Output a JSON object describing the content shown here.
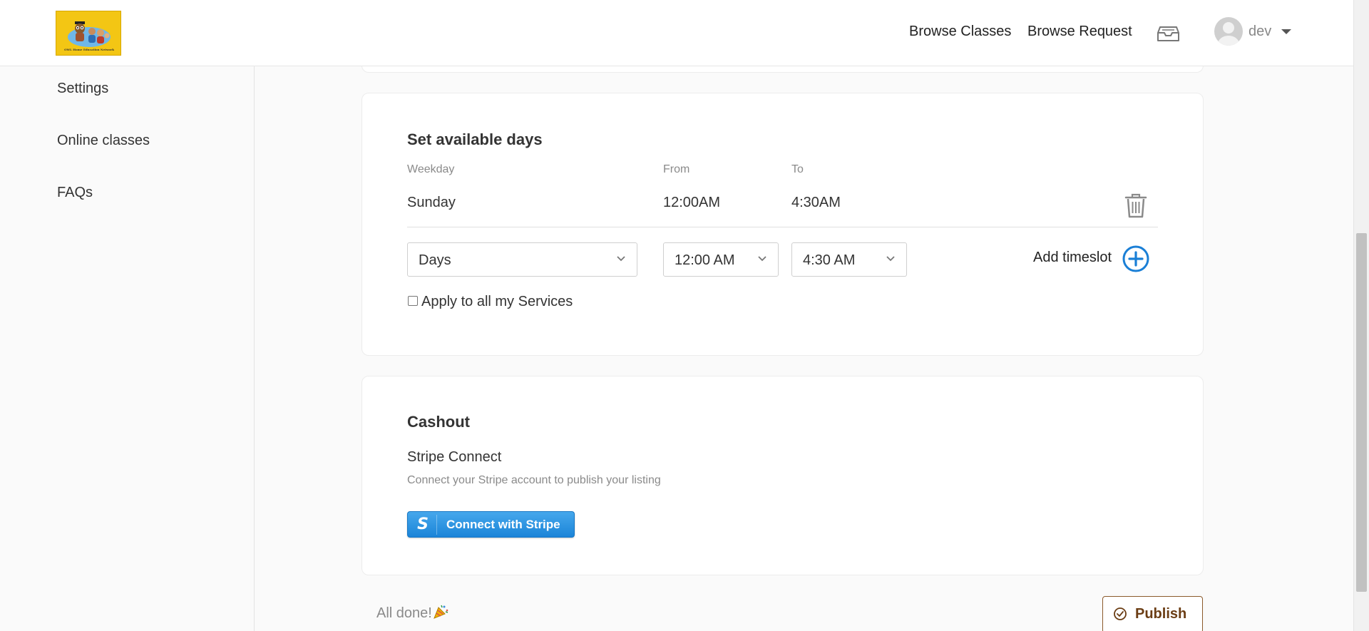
{
  "header": {
    "logo_caption": "OWL Home Education Network",
    "nav": [
      {
        "label": "Browse Classes"
      },
      {
        "label": "Browse Request"
      }
    ],
    "user": {
      "name": "dev"
    }
  },
  "sidebar": {
    "items": [
      {
        "label": "Settings"
      },
      {
        "label": "Online classes"
      },
      {
        "label": "FAQs"
      }
    ]
  },
  "available_days": {
    "title": "Set available days",
    "columns": {
      "weekday": "Weekday",
      "from": "From",
      "to": "To"
    },
    "rows": [
      {
        "weekday": "Sunday",
        "from": "12:00AM",
        "to": "4:30AM"
      }
    ],
    "new_slot": {
      "day_value": "Days",
      "from_value": "12:00 AM",
      "to_value": "4:30 AM",
      "add_label": "Add timeslot"
    },
    "apply_all": {
      "label": "Apply to all my Services",
      "checked": false
    }
  },
  "cashout": {
    "title": "Cashout",
    "stripe_title": "Stripe Connect",
    "stripe_desc": "Connect your Stripe account to publish your listing",
    "stripe_button": "Connect with Stripe",
    "stripe_mark": "S"
  },
  "footer": {
    "status": "All done!",
    "publish_label": "Publish"
  },
  "colors": {
    "accent_blue": "#1a7fd6",
    "stripe_blue": "#2a93e2",
    "publish_brown": "#6b3d14",
    "logo_yellow": "#f3c614"
  }
}
